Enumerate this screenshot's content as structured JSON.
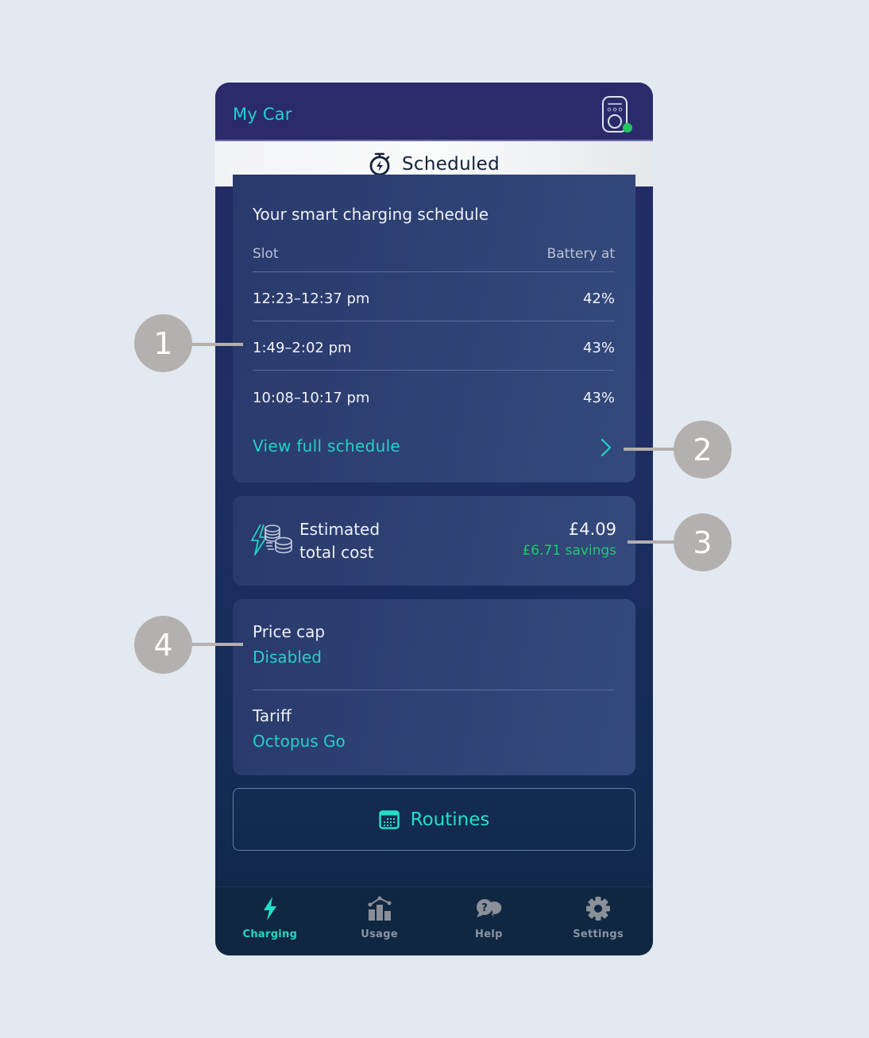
{
  "header": {
    "title": "My Car",
    "charger_status_color": "#22c55e"
  },
  "status_banner": {
    "icon": "stopwatch-bolt-icon",
    "label": "Scheduled"
  },
  "schedule": {
    "title": "Your smart charging schedule",
    "columns": {
      "slot": "Slot",
      "battery": "Battery at"
    },
    "rows": [
      {
        "slot": "12:23–12:37 pm",
        "battery": "42%"
      },
      {
        "slot": "1:49–2:02 pm",
        "battery": "43%"
      },
      {
        "slot": "10:08–10:17 pm",
        "battery": "43%"
      }
    ],
    "view_full_label": "View full schedule"
  },
  "cost": {
    "label_line1": "Estimated",
    "label_line2": "total cost",
    "value": "£4.09",
    "savings": "£6.71 savings"
  },
  "settings": {
    "price_cap_label": "Price cap",
    "price_cap_value": "Disabled",
    "tariff_label": "Tariff",
    "tariff_value": "Octopus Go"
  },
  "routines": {
    "label": "Routines"
  },
  "nav": {
    "items": [
      {
        "label": "Charging",
        "icon": "lightning-icon",
        "active": true
      },
      {
        "label": "Usage",
        "icon": "usage-chart-icon",
        "active": false
      },
      {
        "label": "Help",
        "icon": "help-chat-icon",
        "active": false
      },
      {
        "label": "Settings",
        "icon": "gear-icon",
        "active": false
      }
    ]
  },
  "callouts": [
    "1",
    "2",
    "3",
    "4"
  ],
  "colors": {
    "accent": "#22d3c5",
    "savings": "#1ec96e",
    "header_bg": "#2a2b6b",
    "nav_bg": "#0f2741",
    "callout": "#b4b0ae"
  }
}
